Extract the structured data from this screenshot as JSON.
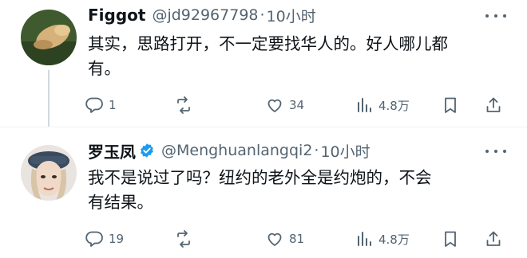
{
  "tweets": [
    {
      "name": "Figgot",
      "handle": "@jd92967798",
      "separator": "·",
      "time": "10小时",
      "text_line1": "其实，思路打开，不一定要找华人的。好人哪儿都",
      "text_line2": "有。",
      "verified": false,
      "replies": "1",
      "retweets": "",
      "likes": "34",
      "views": "4.8万"
    },
    {
      "name": "罗玉凤",
      "handle": "@Menghuanlangqi2",
      "separator": "·",
      "time": "10小时",
      "text_line1": "我不是说过了吗？纽约的老外全是约炮的，不会",
      "text_line2": "有结果。",
      "verified": true,
      "replies": "19",
      "retweets": "",
      "likes": "81",
      "views": "4.8万"
    }
  ],
  "colors": {
    "text": "#0f1419",
    "secondary": "#536471",
    "verified_blue": "#1d9bf0",
    "divider": "#eff3f4"
  },
  "icons": [
    "reply-icon",
    "retweet-icon",
    "like-icon",
    "views-icon",
    "bookmark-icon",
    "share-icon",
    "more-icon",
    "verified-badge-icon"
  ]
}
